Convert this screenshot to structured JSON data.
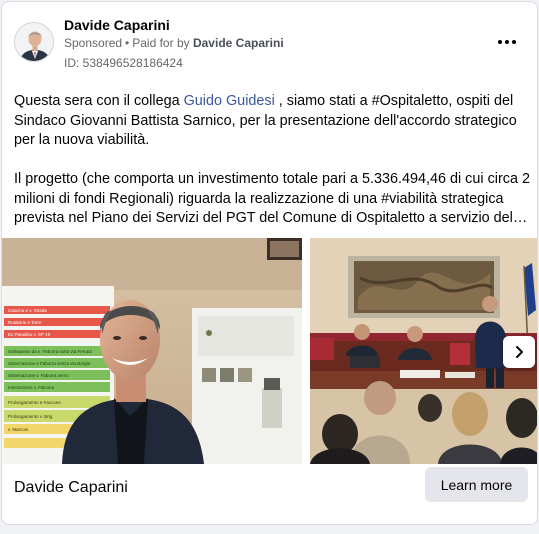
{
  "post": {
    "author": "Davide Caparini",
    "sponsored": "Sponsored",
    "paid_for_prefix": "Paid for by",
    "payer": "Davide Caparini",
    "ad_id": "ID: 538496528186424",
    "body": {
      "p1_before": "Questa sera con il collega ",
      "p1_mention": "Guido Guidesi",
      "p1_after": " , siamo stati a #Ospitaletto, ospiti del Sindaco Giovanni Battista Sarnico, per la presentazione dell'accordo strategico per la nuova viabilità.",
      "p2": "Il progetto (che comporta un investimento totale pari a 5.336.494,46 di cui circa 2 milioni di fondi Regionali) riguarda la realizzazione di una #viabilità strategica prevista nel Piano dei Servizi del PGT del Comune di Ospitaletto a servizio del…"
    },
    "poster_lines": [
      "Cascina e v. Strada",
      "Rotatorie e Torre",
      "Ex Paradiso v. SP 19",
      "Sottopasso da v. Faborra sotto via Ferrata",
      "Sistemazione e Faborra senza via Borgio",
      "Sistemazione v. Faborra verso",
      "Intersezione v. Falcone",
      "Prolungamento e Faccone",
      "Prolungamento v. Brig",
      "v. Marconi"
    ],
    "footer": {
      "name": "Davide Caparini",
      "cta": "Learn more"
    }
  },
  "icons": {
    "more": "more-options-icon",
    "next": "chevron-right-icon"
  },
  "colors": {
    "mention": "#385898",
    "cta_bg": "#e4e6eb",
    "secondary_text": "#65676b"
  }
}
